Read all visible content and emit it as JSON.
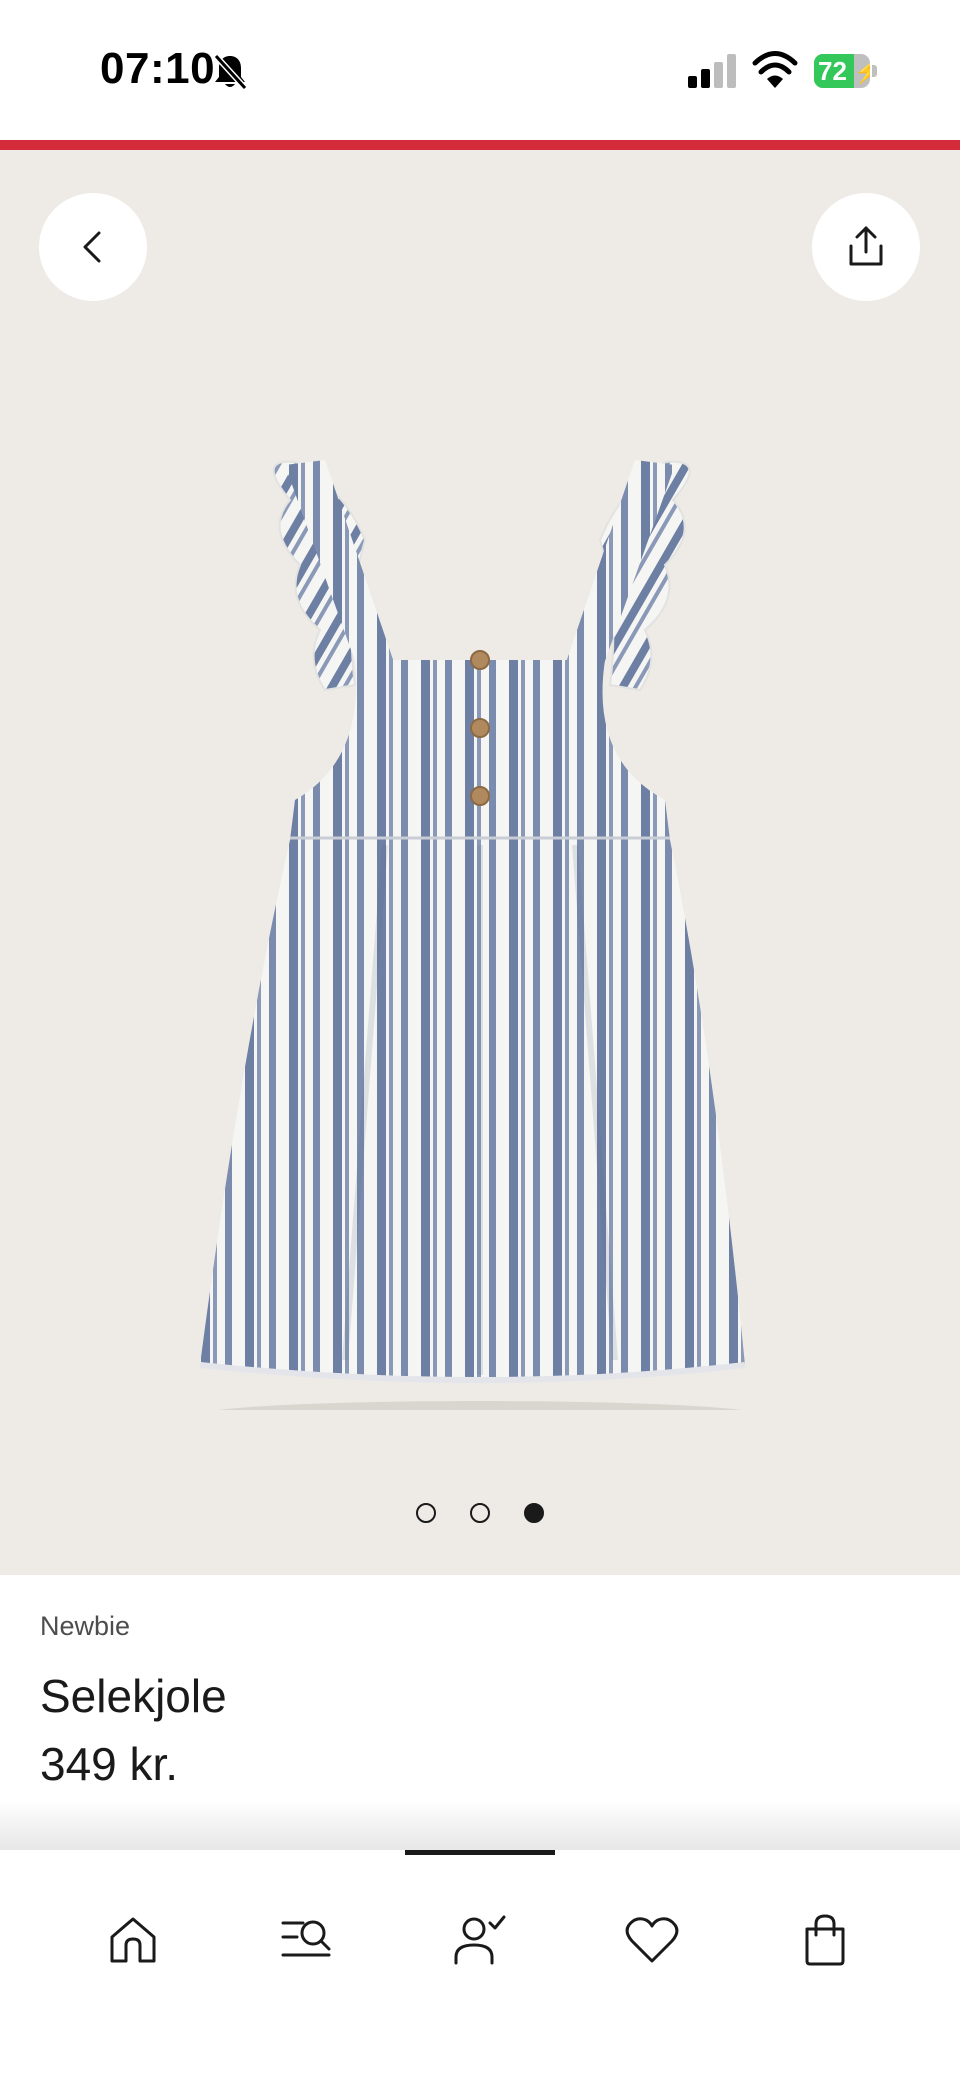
{
  "status_bar": {
    "time": "07:10",
    "battery_percent": "72",
    "battery_level": 0.72,
    "icons": [
      "bell-slash-icon",
      "signal-icon",
      "wifi-icon",
      "battery-charging-icon"
    ]
  },
  "colors": {
    "accent": "#d42b3b",
    "image_background": "#eeebe7",
    "battery_green": "#34c759",
    "text": "#1a1a1a"
  },
  "header_buttons": {
    "back_icon": "chevron-left-icon",
    "share_icon": "share-icon"
  },
  "carousel": {
    "total": 3,
    "active_index": 2
  },
  "product": {
    "brand": "Newbie",
    "name": "Selekjole",
    "price": "349 kr."
  },
  "bottom_nav": {
    "items": [
      {
        "icon": "home-icon"
      },
      {
        "icon": "search-list-icon"
      },
      {
        "icon": "account-check-icon"
      },
      {
        "icon": "heart-icon"
      },
      {
        "icon": "shopping-bag-icon"
      }
    ]
  }
}
